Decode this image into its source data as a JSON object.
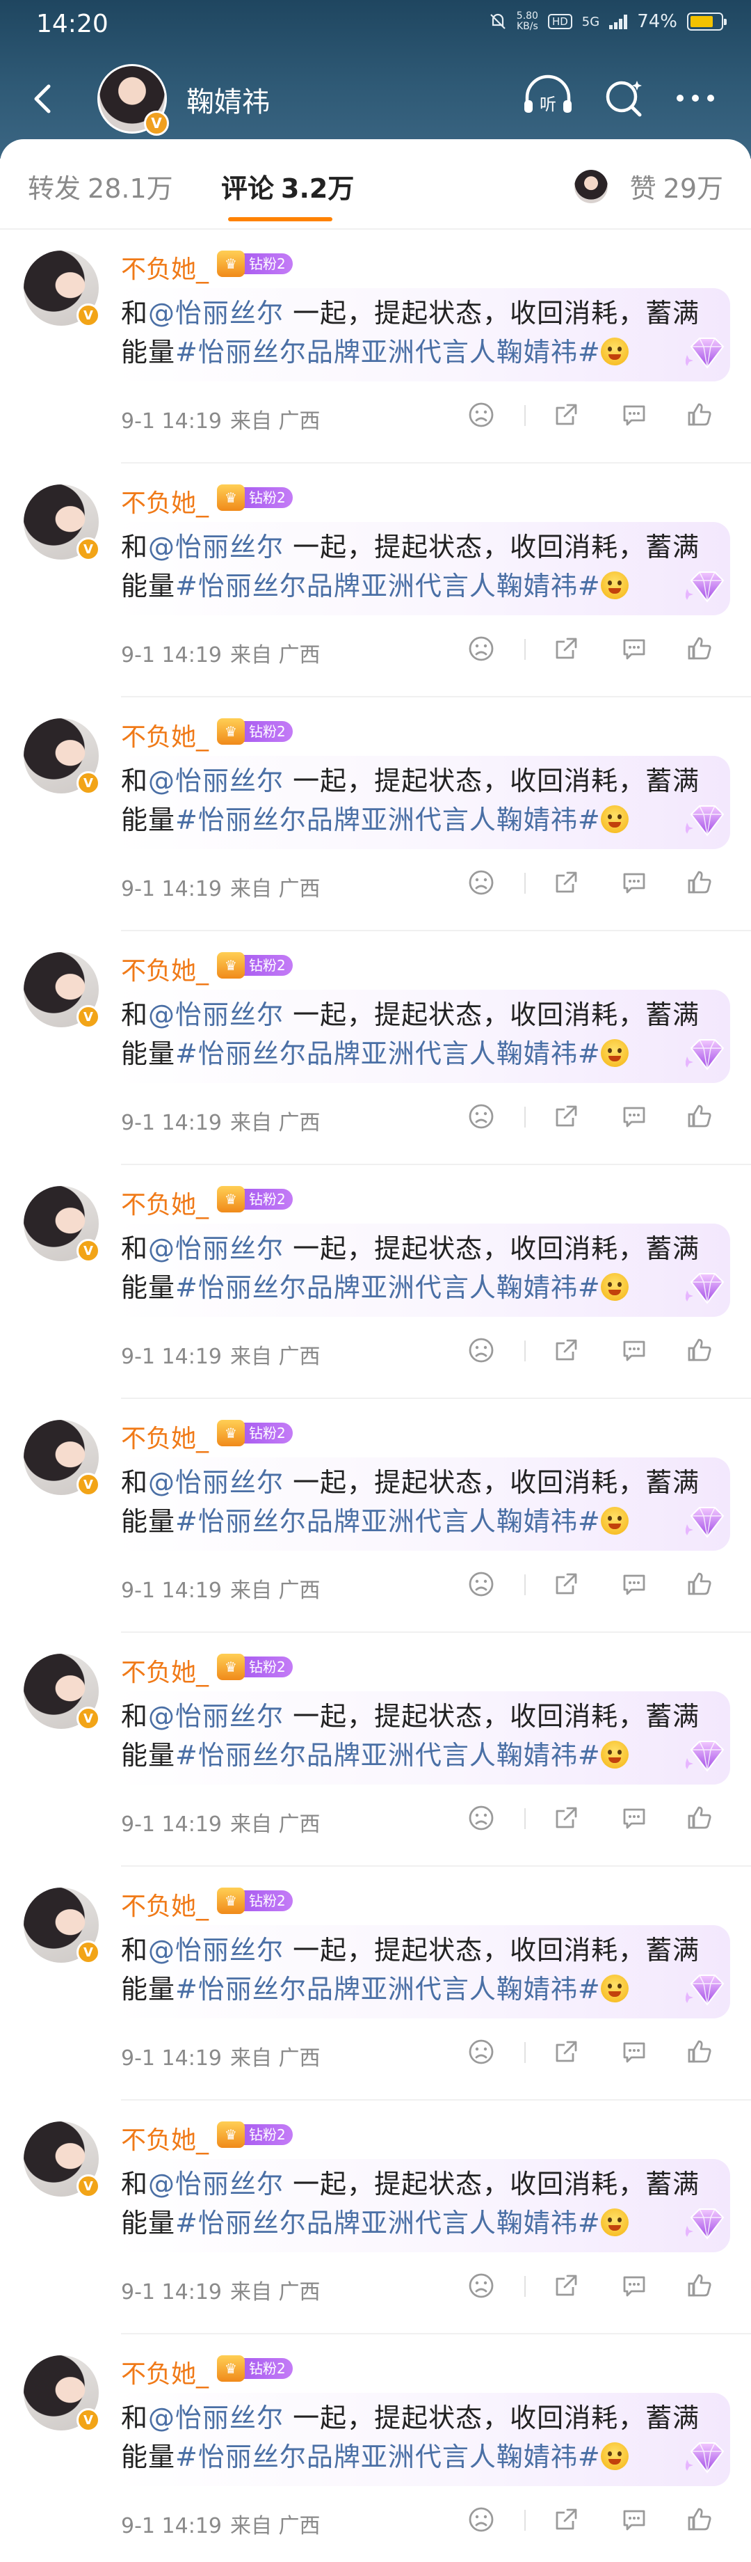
{
  "status_bar": {
    "time": "14:20",
    "net_speed_value": "5.80",
    "net_speed_unit": "KB/s",
    "hd_label": "HD",
    "network_label": "5G",
    "battery_percent": "74%",
    "battery_level": 0.74
  },
  "header": {
    "title": "鞠婧祎",
    "verified_mark": "V",
    "icons": [
      "back-icon",
      "listen-icon",
      "search-icon",
      "more-icon"
    ]
  },
  "tabs": {
    "repost": {
      "label": "转发",
      "count": "28.1万"
    },
    "comments": {
      "label": "评论",
      "count": "3.2万"
    },
    "likes": {
      "label": "赞",
      "count": "29万"
    }
  },
  "comments": [
    {
      "user": "不负她_",
      "badge": "钻粉2",
      "verified_mark": "V",
      "prefix": "和",
      "mention": "@怡丽丝尔",
      "body": " 一起，提起状态，收回消耗，蓄满能量",
      "topic": "#怡丽丝尔品牌亚洲代言人鞠婧祎#",
      "emoji": "laugh-emoji",
      "date": "9-1 14:19",
      "source": "来自 广西"
    },
    {
      "user": "不负她_",
      "badge": "钻粉2",
      "verified_mark": "V",
      "prefix": "和",
      "mention": "@怡丽丝尔",
      "body": " 一起，提起状态，收回消耗，蓄满能量",
      "topic": "#怡丽丝尔品牌亚洲代言人鞠婧祎#",
      "emoji": "party-emoji",
      "date": "9-1 14:19",
      "source": "来自 广西"
    },
    {
      "user": "不负她_",
      "badge": "钻粉2",
      "verified_mark": "V",
      "prefix": "和",
      "mention": "@怡丽丝尔",
      "body": " 一起，提起状态，收回消耗，蓄满能量",
      "topic": "#怡丽丝尔品牌亚洲代言人鞠婧祎#",
      "emoji": "bunny-emoji",
      "date": "9-1 14:19",
      "source": "来自 广西"
    },
    {
      "user": "不负她_",
      "badge": "钻粉2",
      "verified_mark": "V",
      "prefix": "和",
      "mention": "@怡丽丝尔",
      "body": " 一起，提起状态，收回消耗，蓄满能量",
      "topic": "#怡丽丝尔品牌亚洲代言人鞠婧祎#",
      "emoji": "dog-emoji",
      "date": "9-1 14:19",
      "source": "来自 广西"
    },
    {
      "user": "不负她_",
      "badge": "钻粉2",
      "verified_mark": "V",
      "prefix": "和",
      "mention": "@怡丽丝尔",
      "body": " 一起，提起状态，收回消耗，蓄满能量",
      "topic": "#怡丽丝尔品牌亚洲代言人鞠婧祎#",
      "emoji": "heart-eyes-emoji",
      "date": "9-1 14:19",
      "source": "来自 广西"
    },
    {
      "user": "不负她_",
      "badge": "钻粉2",
      "verified_mark": "V",
      "prefix": "和",
      "mention": "@怡丽丝尔",
      "body": " 一起，提起状态，收回消耗，蓄满能量",
      "topic": "#怡丽丝尔品牌亚洲代言人鞠婧祎#",
      "emoji": "star-eyes-emoji",
      "date": "9-1 14:19",
      "source": "来自 广西"
    },
    {
      "user": "不负她_",
      "badge": "钻粉2",
      "verified_mark": "V",
      "prefix": "和",
      "mention": "@怡丽丝尔",
      "body": " 一起，提起状态，收回消耗，蓄满能量",
      "topic": "#怡丽丝尔品牌亚洲代言人鞠婧祎#",
      "emoji": "love-emoji",
      "date": "9-1 14:19",
      "source": "来自 广西"
    },
    {
      "user": "不负她_",
      "badge": "钻粉2",
      "verified_mark": "V",
      "prefix": "和",
      "mention": "@怡丽丝尔",
      "body": " 一起，提起状态，收回消耗，蓄满能量",
      "topic": "#怡丽丝尔品牌亚洲代言人鞠婧祎#",
      "emoji": "smirk-emoji",
      "date": "9-1 14:19",
      "source": "来自 广西"
    },
    {
      "user": "不负她_",
      "badge": "钻粉2",
      "verified_mark": "V",
      "prefix": "和",
      "mention": "@怡丽丝尔",
      "body": " 一起，提起状态，收回消耗，蓄满能量",
      "topic": "#怡丽丝尔品牌亚洲代言人鞠婧祎#",
      "emoji": "grin-emoji",
      "date": "9-1 14:19",
      "source": "来自 广西"
    },
    {
      "user": "不负她_",
      "badge": "钻粉2",
      "verified_mark": "V",
      "prefix": "和",
      "mention": "@怡丽丝尔",
      "body": " 一起，提起状态，收回消耗，蓄满能量",
      "topic": "#怡丽丝尔品牌亚洲代言人鞠婧祎#",
      "emoji": "thinking-emoji",
      "date": "9-1 14:19",
      "source": "来自 广西"
    }
  ],
  "colors": {
    "header_bg": "#2f5a76",
    "username": "#f07a18",
    "link": "#4a6fa5",
    "tab_accent": "#ff8200",
    "badge": "#a85cf0"
  }
}
